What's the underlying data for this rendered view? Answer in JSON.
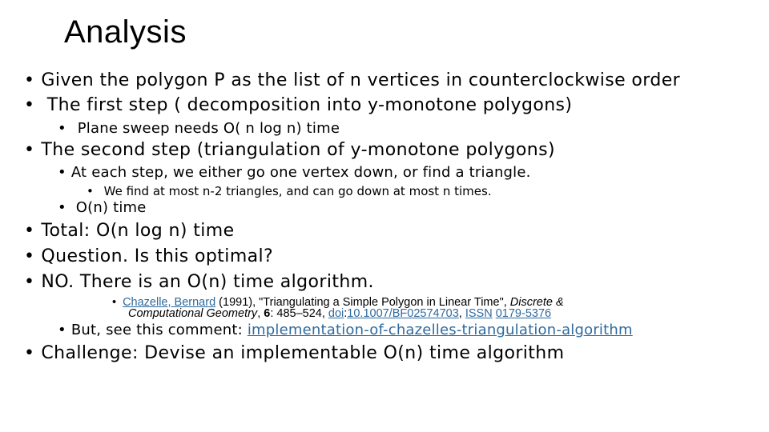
{
  "slide": {
    "title": "Analysis",
    "bullet_glyph": "•",
    "items": [
      {
        "text": "Given the polygon P as the list of n vertices in counterclockwise order"
      },
      {
        "text": " The first step ( decomposition into y-monotone polygons)"
      },
      {
        "text": " Plane sweep needs O( n log n) time"
      },
      {
        "text": "The second step (triangulation of y-monotone polygons)"
      },
      {
        "text": "At each step, we either go one vertex down, or find a triangle."
      },
      {
        "text": " We find at most n-2 triangles, and can go down at most n times."
      },
      {
        "text": " O(n) time"
      },
      {
        "text": "Total:  O(n log n) time"
      },
      {
        "text": "Question.  Is this optimal?"
      },
      {
        "text": "NO.   There is an O(n) time algorithm."
      },
      {
        "text": "But, see this comment:  "
      },
      {
        "text": "Challenge:  Devise an implementable O(n) time algorithm"
      }
    ],
    "reference": {
      "author_link": "Chazelle, Bernard",
      "year": " (1991), \"Triangulating a Simple Polygon in Linear Time\", ",
      "journal_1": "Discrete &",
      "journal_2": "Computational Geometry",
      "sep": ", ",
      "volume": "6",
      "pages": ": 485–524, ",
      "doi_label": "doi",
      "doi_colon": ":",
      "doi_value": "10.1007/BF02574703",
      "comma": ", ",
      "issn_label": "ISSN",
      "space": " ",
      "issn_value": "0179-5376"
    },
    "comment_link": "implementation-of-chazelles-triangulation-algorithm"
  }
}
